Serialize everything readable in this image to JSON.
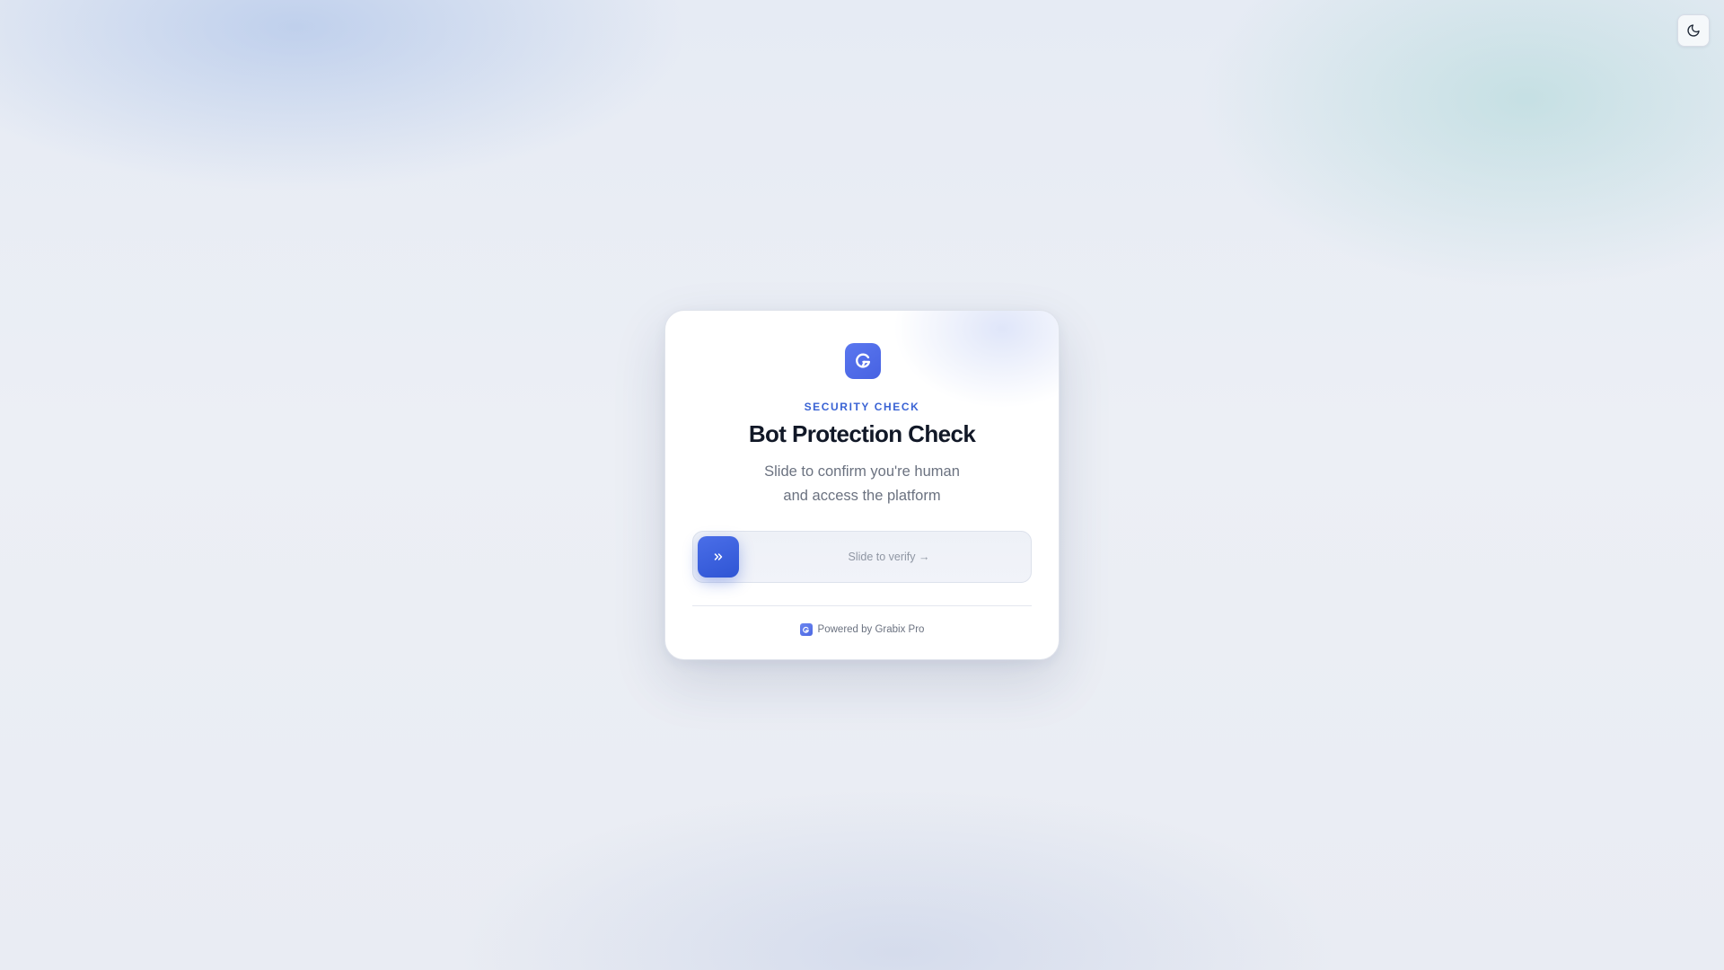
{
  "theme_toggle": {
    "icon": "moon-icon"
  },
  "card": {
    "logo_icon": "grabix-logo-icon",
    "eyebrow": "SECURITY CHECK",
    "title": "Bot Protection Check",
    "subtitle_lines": [
      "Slide to confirm you're human",
      "and access the platform"
    ]
  },
  "slider": {
    "handle_icon": "double-chevron-right-icon",
    "label": "Slide to verify →",
    "progress": 0
  },
  "footer": {
    "logo_icon": "grabix-logo-icon",
    "text": "Powered by Grabix Pro"
  },
  "colors": {
    "accent": "#3a63d4",
    "handle": "#2f55d4",
    "logo": "#4f6ae6",
    "title": "#111827",
    "muted": "#6b7280"
  }
}
